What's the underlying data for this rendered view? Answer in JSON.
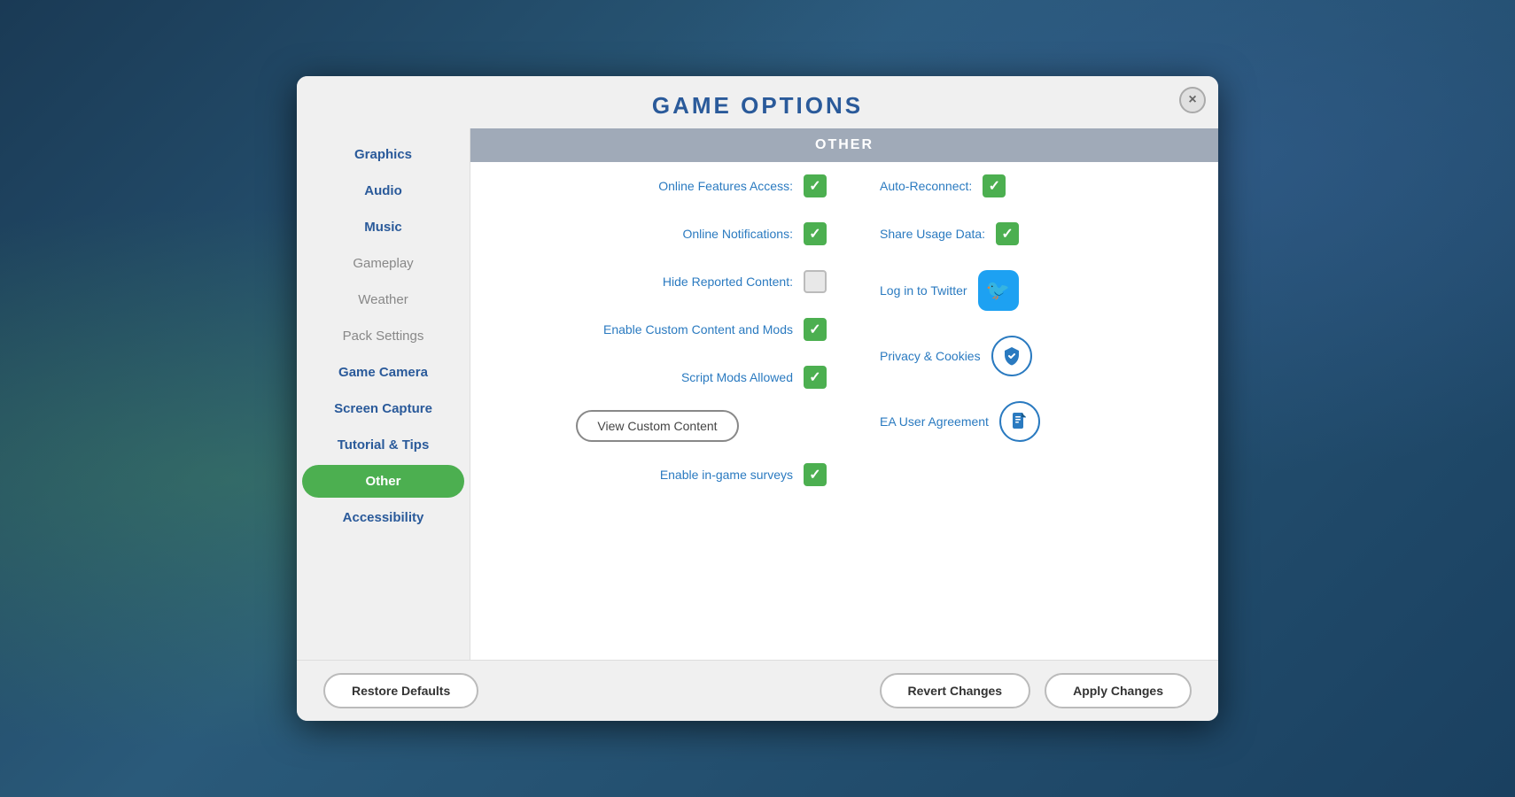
{
  "modal": {
    "title": "Game Options",
    "close_label": "×"
  },
  "sidebar": {
    "items": [
      {
        "id": "graphics",
        "label": "Graphics",
        "state": "bold"
      },
      {
        "id": "audio",
        "label": "Audio",
        "state": "bold"
      },
      {
        "id": "music",
        "label": "Music",
        "state": "bold"
      },
      {
        "id": "gameplay",
        "label": "Gameplay",
        "state": "normal"
      },
      {
        "id": "weather",
        "label": "Weather",
        "state": "normal"
      },
      {
        "id": "pack-settings",
        "label": "Pack Settings",
        "state": "normal"
      },
      {
        "id": "game-camera",
        "label": "Game Camera",
        "state": "bold"
      },
      {
        "id": "screen-capture",
        "label": "Screen Capture",
        "state": "bold"
      },
      {
        "id": "tutorial-tips",
        "label": "Tutorial & Tips",
        "state": "bold"
      },
      {
        "id": "other",
        "label": "Other",
        "state": "active"
      },
      {
        "id": "accessibility",
        "label": "Accessibility",
        "state": "bold"
      }
    ]
  },
  "content": {
    "section_title": "Other",
    "left_settings": [
      {
        "id": "online-features",
        "label": "Online Features Access:",
        "checked": true
      },
      {
        "id": "online-notifications",
        "label": "Online Notifications:",
        "checked": true
      },
      {
        "id": "hide-reported",
        "label": "Hide Reported Content:",
        "checked": false
      },
      {
        "id": "enable-custom-mods",
        "label": "Enable Custom Content and Mods",
        "checked": true
      },
      {
        "id": "script-mods",
        "label": "Script Mods Allowed",
        "checked": true
      }
    ],
    "right_settings": [
      {
        "id": "auto-reconnect",
        "label": "Auto-Reconnect:",
        "checked": true
      },
      {
        "id": "share-usage",
        "label": "Share Usage Data:",
        "checked": true
      },
      {
        "id": "log-twitter",
        "label": "Log in to Twitter",
        "type": "twitter"
      },
      {
        "id": "privacy-cookies",
        "label": "Privacy & Cookies",
        "type": "shield"
      },
      {
        "id": "ea-user-agreement",
        "label": "EA User Agreement",
        "type": "document"
      }
    ],
    "view_custom_content_btn": "View Custom Content",
    "enable_surveys": {
      "label": "Enable in-game surveys",
      "checked": true
    }
  },
  "footer": {
    "restore_defaults": "Restore Defaults",
    "revert_changes": "Revert Changes",
    "apply_changes": "Apply Changes"
  }
}
